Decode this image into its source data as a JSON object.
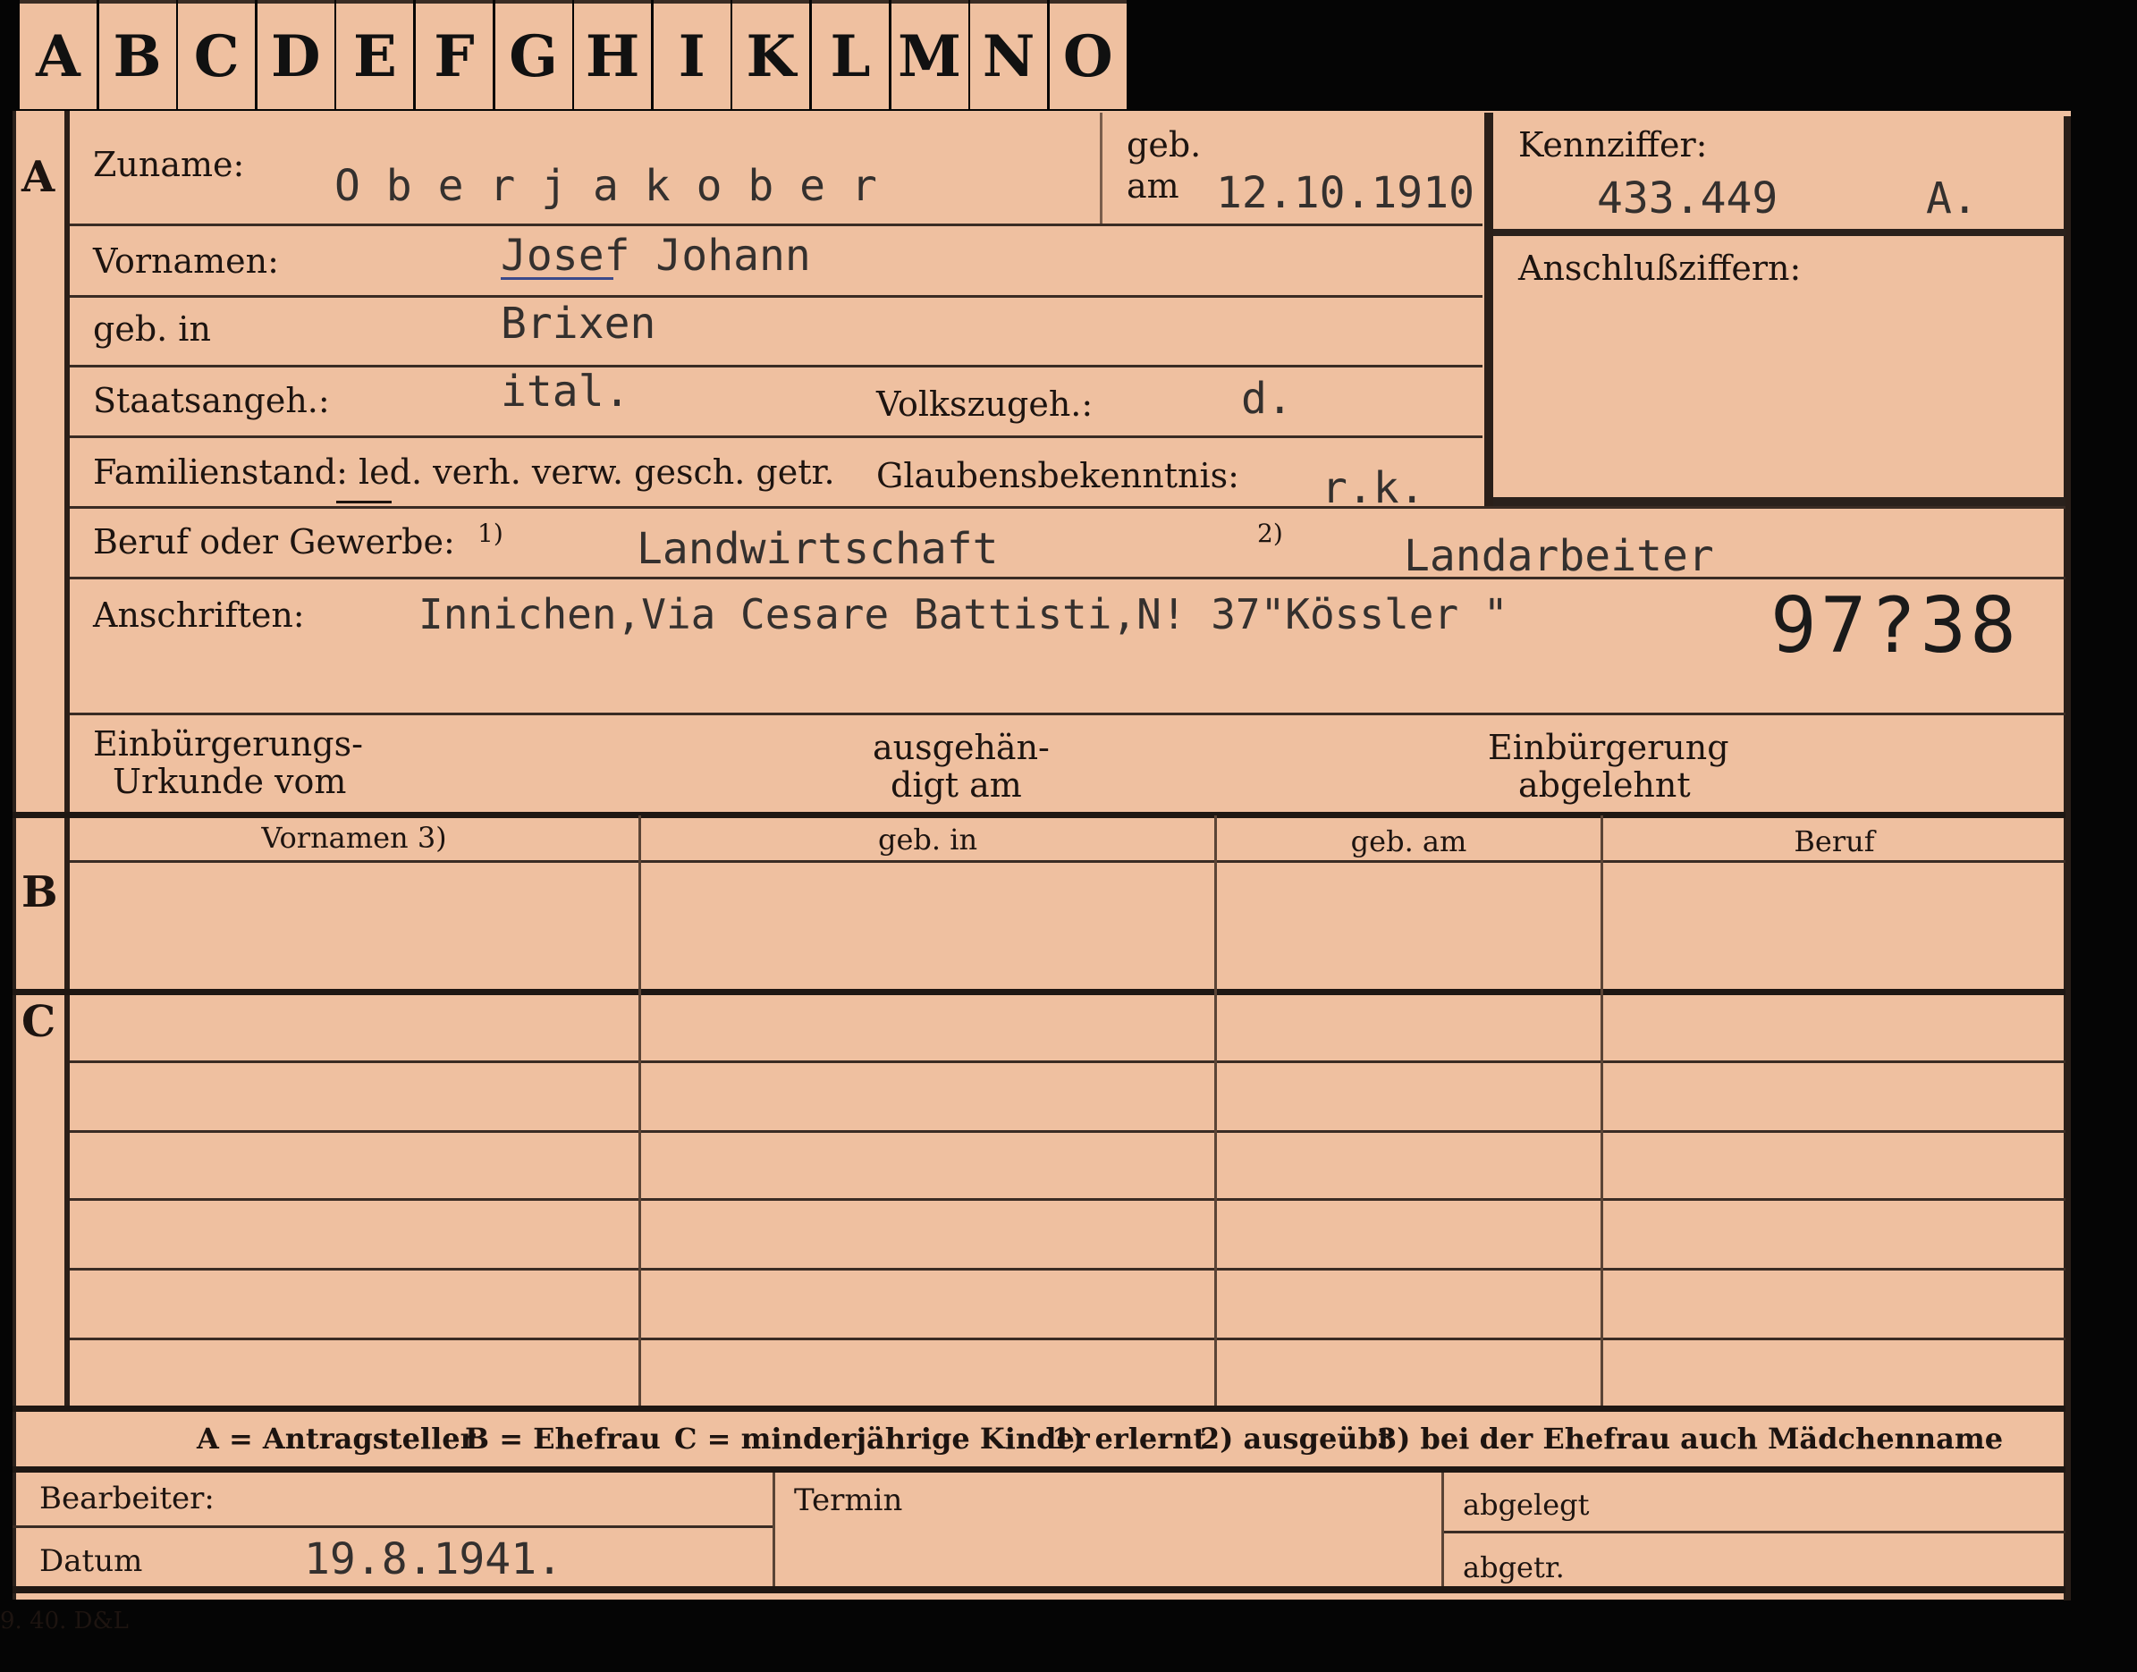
{
  "tabs": [
    "A",
    "B",
    "C",
    "D",
    "E",
    "F",
    "G",
    "H",
    "I",
    "K",
    "L",
    "M",
    "N",
    "O"
  ],
  "sections": {
    "a": "A",
    "b": "B",
    "c": "C"
  },
  "labels": {
    "zuname": "Zuname:",
    "geb": "geb.",
    "am": "am",
    "kennziffer": "Kennziffer:",
    "anschlussziffern": "Anschlußziffern:",
    "vornamen": "Vornamen:",
    "geb_in": "geb. in",
    "staatsangeh": "Staatsangeh.:",
    "volkszugeh": "Volkszugeh.:",
    "familienstand": "Familienstand: led. verh. verw. gesch. getr.",
    "glaubens": "Glaubensbekenntnis:",
    "beruf": "Beruf oder Gewerbe:",
    "fn1": "1)",
    "fn2": "2)",
    "anschriften": "Anschriften:",
    "einb_urkunde_1": "Einbürgerungs-",
    "einb_urkunde_2": "Urkunde vom",
    "ausgehaen_1": "ausgehän-",
    "ausgehaen_2": "digt am",
    "einb_abgelehnt_1": "Einbürgerung",
    "einb_abgelehnt_2": "abgelehnt"
  },
  "values": {
    "zuname": "O b e r j a k o b e r",
    "geb_am": "12.10.1910",
    "kennziffer": "433.449",
    "kennziffer_suffix": "A.",
    "vornamen": "Josef Johann",
    "geb_in": "Brixen",
    "staatsangeh": "ital.",
    "volkszugeh": "d.",
    "glaubens": "r.k.",
    "beruf_erlernt": "Landwirtschaft",
    "beruf_ausgeuebt": "Landarbeiter",
    "anschrift": "Innichen,Via Cesare Battisti,N! 37\"Kössler \"",
    "stamp_number": "97?38"
  },
  "table_headers": [
    "Vornamen 3)",
    "geb. in",
    "geb. am",
    "Beruf"
  ],
  "legend": {
    "a": "A = Antragsteller",
    "b": "B = Ehefrau",
    "c": "C = minderjährige Kinder",
    "n1": "1) erlernt",
    "n2": "2) ausgeübt",
    "n3": "3) bei der Ehefrau auch Mädchenname"
  },
  "bottom": {
    "bearbeiter": "Bearbeiter:",
    "termin": "Termin",
    "abgelegt": "abgelegt",
    "datum": "Datum",
    "datum_value": "19.8.1941.",
    "abgetr": "abgetr."
  },
  "printer_mark": "9. 40. D&L"
}
